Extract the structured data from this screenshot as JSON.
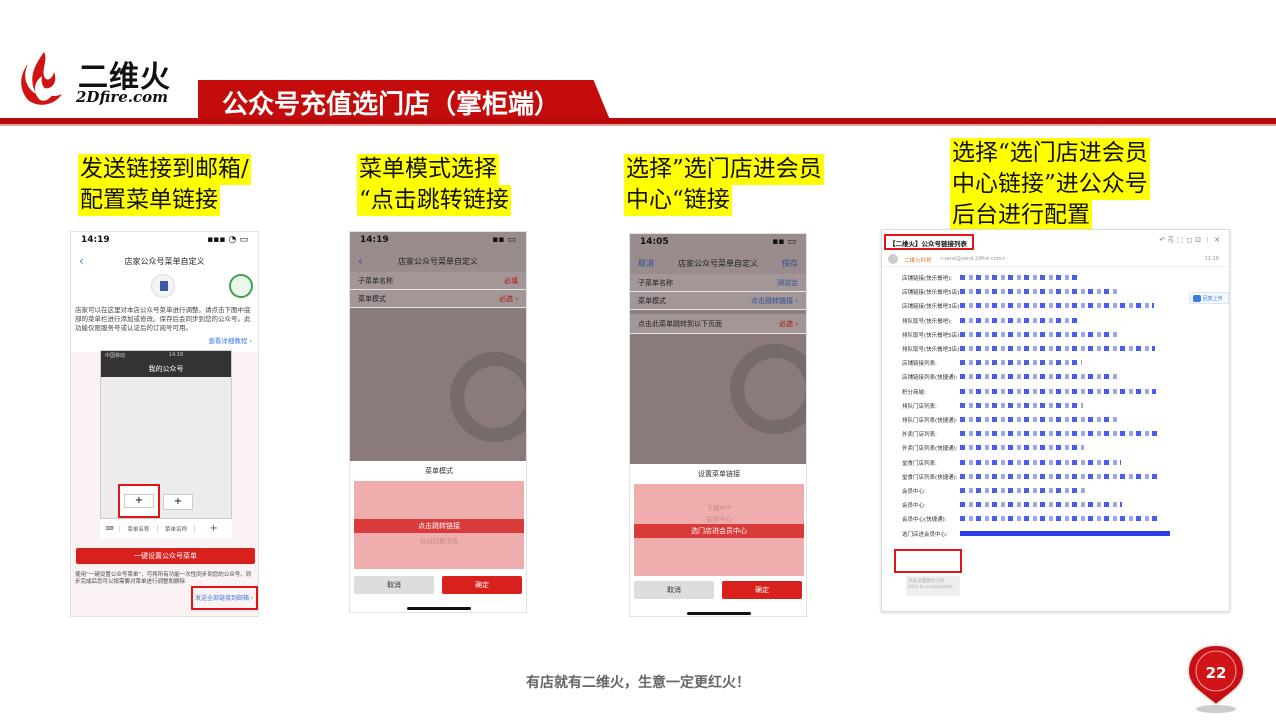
{
  "brand": {
    "name_cn": "二维火",
    "name_en": "2Dfire.com"
  },
  "slide_title": "公众号充值选门店（掌柜端）",
  "captions": [
    {
      "line1": "发送链接到邮箱/",
      "line2": "配置菜单链接"
    },
    {
      "line1": "菜单模式选择",
      "line2": "“点击跳转链接"
    },
    {
      "line1": "选择”选门店进会员",
      "line2": "中心“链接"
    },
    {
      "line1": "选择“选门店进会员",
      "line2": "中心链接”进公众号",
      "line3": "后台进行配置"
    }
  ],
  "phone1": {
    "time": "14:19",
    "status_icons": "▪▪▪ ◔ ▭",
    "nav_title": "店家公众号菜单自定义",
    "desc": "店家可以在这里对本店公众号菜单进行调整。请点击下图中底部的菜单栏进行添加或修改。保存后会同步到您的公众号。此功能仅限服务号或认证后的订阅号可用。",
    "link": "查看详细教程 ›",
    "inner_status": "中国移动",
    "inner_time": "14:18",
    "inner_title": "我的公众号",
    "plus": "+",
    "menu_name_1": "菜单名称",
    "menu_name_2": "菜单名称",
    "sync_btn": "一键设置公众号菜单",
    "note": "使用“一键设置公众号菜单”，可将所有功能一次性同步到您的公众号。同步完成后您可以按需要对菜单进行调整和删除",
    "send_link": "发送全部链接到邮箱 ›"
  },
  "phone2": {
    "time": "14:19",
    "nav_title": "店家公众号菜单自定义",
    "rows": [
      {
        "label": "子菜单名称",
        "value": "必填"
      },
      {
        "label": "菜单模式",
        "value": "必选 ›"
      }
    ],
    "sheet_title": "菜单模式",
    "options": [
      "点击跳转链接",
      "自动回复消息"
    ],
    "cancel": "取消",
    "confirm": "确定"
  },
  "phone3": {
    "time": "14:05",
    "left": "取消",
    "nav_title": "店家公众号菜单自定义",
    "right": "保存",
    "rows": [
      {
        "label": "子菜单名称",
        "value": "测试会"
      },
      {
        "label": "菜单模式",
        "value": "点击跳转链接 ›"
      },
      {
        "label": "点击此菜单跳转到以下页面",
        "value": "必选 ›"
      }
    ],
    "sheet_title": "设置菜单链接",
    "options": [
      "下载APP",
      "会员中心",
      "选门店进会员中心"
    ],
    "cancel": "取消",
    "confirm": "确定"
  },
  "email": {
    "subject": "【二维火】公众号链接列表",
    "sender": "二维火科技",
    "sender_addr": "<send@send.2dfire.com>",
    "date": "12:16",
    "side_btn": "回复上传",
    "lines": [
      "店铺链接(快乐餐吧):",
      "店铺链接(快乐餐吧5店):",
      "店铺链接(快乐餐吧3店):",
      "排队取号(快乐餐吧):",
      "排队取号(快乐餐吧5店):",
      "排队取号(快乐餐吧3店):",
      "店铺链接列表:",
      "店铺链接列表(快捷通):",
      "积分商城:",
      "排队门店列表:",
      "排队门店列表(快捷通):",
      "外卖门店列表:",
      "外卖门店列表(快捷通):",
      "堂食门店列表:",
      "堂食门店列表(快捷通):",
      "会员中心:",
      "会员中心:",
      "会员中心(快捷通):",
      "选门店进会员中心:"
    ],
    "bottom_btn1": "点击设置图标订阅",
    "bottom_btn2": "click to unsubscribe"
  },
  "footer": "有店就有二维火，生意一定更红火！",
  "page_number": "22",
  "colors": {
    "brand_red": "#c40c0c",
    "highlight": "#ffff00"
  }
}
